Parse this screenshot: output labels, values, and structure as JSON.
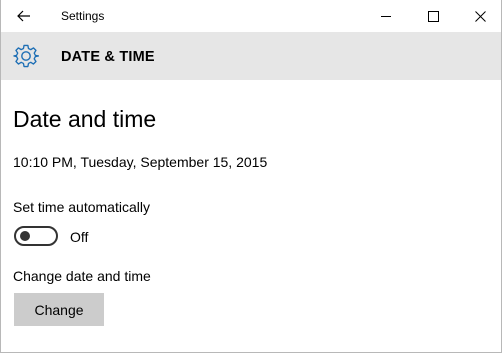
{
  "titlebar": {
    "title": "Settings",
    "icons": {
      "back": "back-arrow-icon",
      "minimize": "minimize-icon",
      "maximize": "maximize-icon",
      "close": "close-icon"
    }
  },
  "header": {
    "icon": "gear-icon",
    "title": "DATE & TIME"
  },
  "main": {
    "page_title": "Date and time",
    "current_datetime": "10:10 PM, Tuesday, September 15, 2015",
    "auto_time": {
      "label": "Set time automatically",
      "state_label": "Off",
      "enabled": false
    },
    "change_section": {
      "label": "Change date and time",
      "button_label": "Change"
    }
  },
  "colors": {
    "accent": "#1e6fb5",
    "header_bg": "#e6e6e6",
    "button_bg": "#cccccc"
  }
}
